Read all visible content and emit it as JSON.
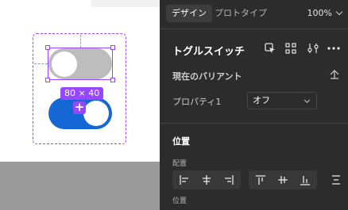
{
  "canvas": {
    "size_badge": "80 × 40",
    "add_variant_glyph": "+",
    "variants": [
      {
        "name": "toggle-off",
        "state": "off",
        "track_color": "#bdbdbd"
      },
      {
        "name": "toggle-on",
        "state": "on",
        "track_color": "#1667d6"
      }
    ],
    "selection_color": "#9747ff"
  },
  "panel": {
    "tabs": [
      {
        "label": "デザイン",
        "active": true
      },
      {
        "label": "プロトタイプ",
        "active": false
      }
    ],
    "zoom": "100%",
    "component_name": "トグルスイッチ",
    "header_icons": [
      "go-to-main-component-icon",
      "variants-grid-icon",
      "adjust-icon",
      "more-icon"
    ],
    "current_variant": {
      "heading": "現在のバリアント",
      "icon": "collapse-icon",
      "property_label": "プロパティ1",
      "property_value": "オフ"
    },
    "position": {
      "heading": "位置",
      "align_label": "配置",
      "align_icons": [
        "align-left-icon",
        "align-center-h-icon",
        "align-right-icon",
        "align-top-icon",
        "align-center-v-icon",
        "align-bottom-icon",
        "distribute-icon"
      ],
      "position_label": "位置"
    }
  }
}
